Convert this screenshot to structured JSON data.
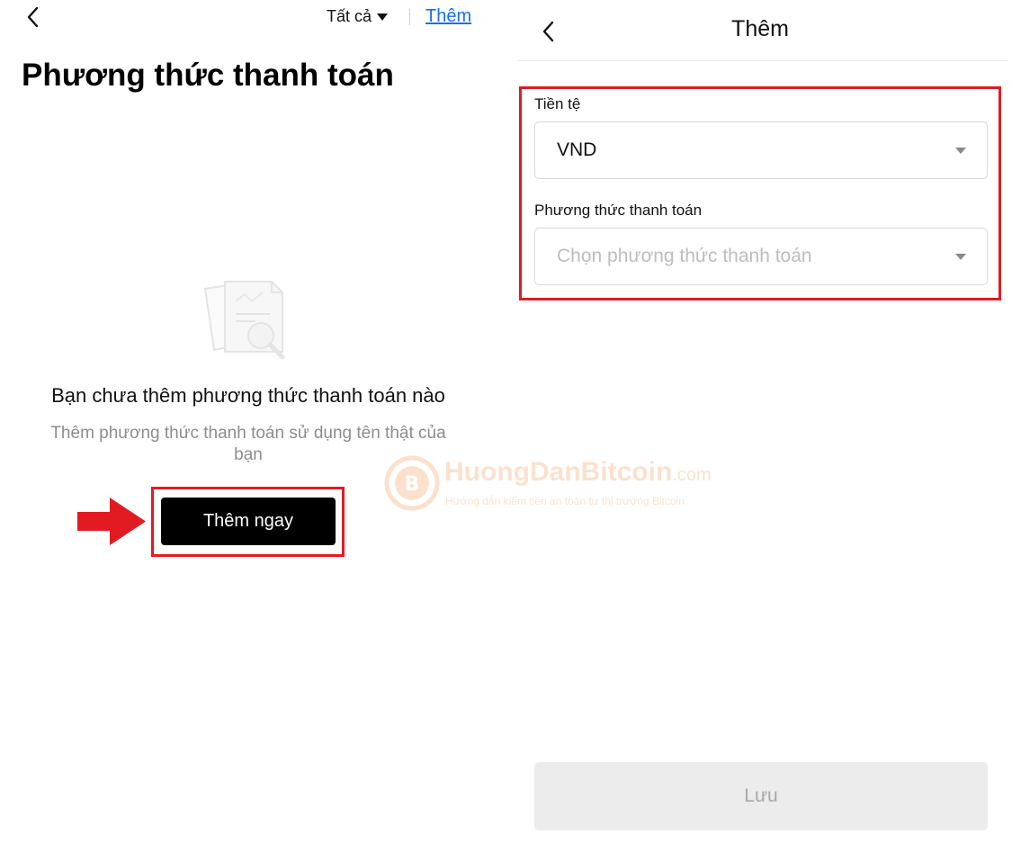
{
  "left": {
    "filter_label": "Tất cả",
    "add_link": "Thêm",
    "title": "Phương thức thanh toán",
    "empty_title": "Bạn chưa thêm phương thức thanh toán nào",
    "empty_subtitle": "Thêm phương thức thanh toán sử dụng tên thật của bạn",
    "add_now_button": "Thêm ngay"
  },
  "right": {
    "header_title": "Thêm",
    "currency_label": "Tiền tệ",
    "currency_value": "VND",
    "payment_method_label": "Phương thức thanh toán",
    "payment_method_placeholder": "Chọn phương thức thanh toán",
    "save_button": "Lưu"
  },
  "watermark": {
    "brand": "HuongDanBitcoin",
    "brand_suffix": ".com",
    "tagline": "Hướng dẫn kiếm tiền an toàn từ thị trường Bitcoin"
  },
  "colors": {
    "highlight": "#e21b22",
    "link": "#1b6ef3",
    "primary_button": "#000000",
    "disabled_button": "#ececec",
    "watermark": "#f07b22"
  },
  "icons": [
    "back-chevron-icon",
    "caret-down-icon",
    "document-search-icon",
    "dropdown-arrow-icon",
    "red-arrow-icon",
    "bitcoin-logo-icon"
  ]
}
